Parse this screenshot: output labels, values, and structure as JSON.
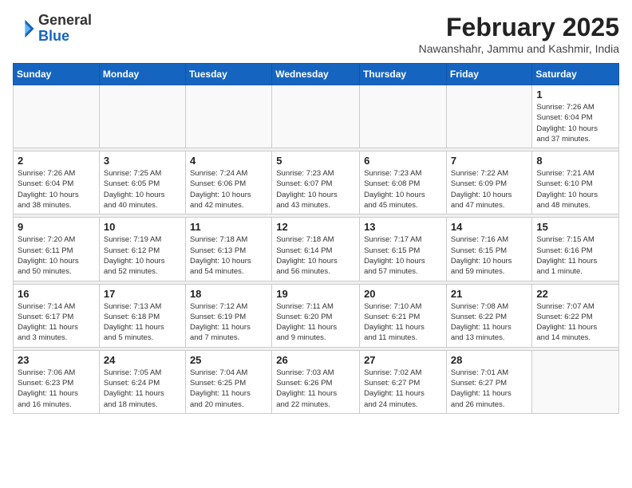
{
  "header": {
    "logo_general": "General",
    "logo_blue": "Blue",
    "month_year": "February 2025",
    "location": "Nawanshahr, Jammu and Kashmir, India"
  },
  "weekdays": [
    "Sunday",
    "Monday",
    "Tuesday",
    "Wednesday",
    "Thursday",
    "Friday",
    "Saturday"
  ],
  "weeks": [
    [
      {
        "day": "",
        "info": ""
      },
      {
        "day": "",
        "info": ""
      },
      {
        "day": "",
        "info": ""
      },
      {
        "day": "",
        "info": ""
      },
      {
        "day": "",
        "info": ""
      },
      {
        "day": "",
        "info": ""
      },
      {
        "day": "1",
        "info": "Sunrise: 7:26 AM\nSunset: 6:04 PM\nDaylight: 10 hours\nand 37 minutes."
      }
    ],
    [
      {
        "day": "2",
        "info": "Sunrise: 7:26 AM\nSunset: 6:04 PM\nDaylight: 10 hours\nand 38 minutes."
      },
      {
        "day": "3",
        "info": "Sunrise: 7:25 AM\nSunset: 6:05 PM\nDaylight: 10 hours\nand 40 minutes."
      },
      {
        "day": "4",
        "info": "Sunrise: 7:24 AM\nSunset: 6:06 PM\nDaylight: 10 hours\nand 42 minutes."
      },
      {
        "day": "5",
        "info": "Sunrise: 7:23 AM\nSunset: 6:07 PM\nDaylight: 10 hours\nand 43 minutes."
      },
      {
        "day": "6",
        "info": "Sunrise: 7:23 AM\nSunset: 6:08 PM\nDaylight: 10 hours\nand 45 minutes."
      },
      {
        "day": "7",
        "info": "Sunrise: 7:22 AM\nSunset: 6:09 PM\nDaylight: 10 hours\nand 47 minutes."
      },
      {
        "day": "8",
        "info": "Sunrise: 7:21 AM\nSunset: 6:10 PM\nDaylight: 10 hours\nand 48 minutes."
      }
    ],
    [
      {
        "day": "9",
        "info": "Sunrise: 7:20 AM\nSunset: 6:11 PM\nDaylight: 10 hours\nand 50 minutes."
      },
      {
        "day": "10",
        "info": "Sunrise: 7:19 AM\nSunset: 6:12 PM\nDaylight: 10 hours\nand 52 minutes."
      },
      {
        "day": "11",
        "info": "Sunrise: 7:18 AM\nSunset: 6:13 PM\nDaylight: 10 hours\nand 54 minutes."
      },
      {
        "day": "12",
        "info": "Sunrise: 7:18 AM\nSunset: 6:14 PM\nDaylight: 10 hours\nand 56 minutes."
      },
      {
        "day": "13",
        "info": "Sunrise: 7:17 AM\nSunset: 6:15 PM\nDaylight: 10 hours\nand 57 minutes."
      },
      {
        "day": "14",
        "info": "Sunrise: 7:16 AM\nSunset: 6:15 PM\nDaylight: 10 hours\nand 59 minutes."
      },
      {
        "day": "15",
        "info": "Sunrise: 7:15 AM\nSunset: 6:16 PM\nDaylight: 11 hours\nand 1 minute."
      }
    ],
    [
      {
        "day": "16",
        "info": "Sunrise: 7:14 AM\nSunset: 6:17 PM\nDaylight: 11 hours\nand 3 minutes."
      },
      {
        "day": "17",
        "info": "Sunrise: 7:13 AM\nSunset: 6:18 PM\nDaylight: 11 hours\nand 5 minutes."
      },
      {
        "day": "18",
        "info": "Sunrise: 7:12 AM\nSunset: 6:19 PM\nDaylight: 11 hours\nand 7 minutes."
      },
      {
        "day": "19",
        "info": "Sunrise: 7:11 AM\nSunset: 6:20 PM\nDaylight: 11 hours\nand 9 minutes."
      },
      {
        "day": "20",
        "info": "Sunrise: 7:10 AM\nSunset: 6:21 PM\nDaylight: 11 hours\nand 11 minutes."
      },
      {
        "day": "21",
        "info": "Sunrise: 7:08 AM\nSunset: 6:22 PM\nDaylight: 11 hours\nand 13 minutes."
      },
      {
        "day": "22",
        "info": "Sunrise: 7:07 AM\nSunset: 6:22 PM\nDaylight: 11 hours\nand 14 minutes."
      }
    ],
    [
      {
        "day": "23",
        "info": "Sunrise: 7:06 AM\nSunset: 6:23 PM\nDaylight: 11 hours\nand 16 minutes."
      },
      {
        "day": "24",
        "info": "Sunrise: 7:05 AM\nSunset: 6:24 PM\nDaylight: 11 hours\nand 18 minutes."
      },
      {
        "day": "25",
        "info": "Sunrise: 7:04 AM\nSunset: 6:25 PM\nDaylight: 11 hours\nand 20 minutes."
      },
      {
        "day": "26",
        "info": "Sunrise: 7:03 AM\nSunset: 6:26 PM\nDaylight: 11 hours\nand 22 minutes."
      },
      {
        "day": "27",
        "info": "Sunrise: 7:02 AM\nSunset: 6:27 PM\nDaylight: 11 hours\nand 24 minutes."
      },
      {
        "day": "28",
        "info": "Sunrise: 7:01 AM\nSunset: 6:27 PM\nDaylight: 11 hours\nand 26 minutes."
      },
      {
        "day": "",
        "info": ""
      }
    ]
  ]
}
